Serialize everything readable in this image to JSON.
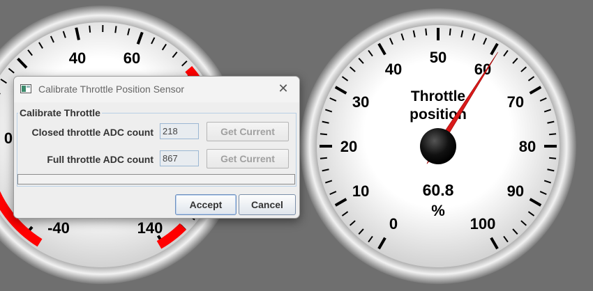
{
  "gauges": {
    "left": {
      "labels": [
        "40",
        "60",
        "0",
        "-40",
        "140"
      ]
    },
    "throttle": {
      "title_line1": "Throttle",
      "title_line2": "position",
      "value": "60.8",
      "unit": "%",
      "reading": 60.8,
      "scale_min": 0,
      "scale_max": 100,
      "tick_labels": [
        "0",
        "10",
        "20",
        "30",
        "40",
        "50",
        "60",
        "70",
        "80",
        "90",
        "100"
      ],
      "needle_color": "#d91a1a"
    },
    "redzone_color": "#ff0000"
  },
  "dialog": {
    "title": "Calibrate Throttle Position Sensor",
    "close_icon": "close-icon",
    "group_label": "Calibrate Throttle",
    "closed_label": "Closed throttle ADC count",
    "closed_value": "218",
    "full_label": "Full throttle ADC count",
    "full_value": "867",
    "get_current_label": "Get Current",
    "progress": 0,
    "accept_label": "Accept",
    "cancel_label": "Cancel"
  }
}
